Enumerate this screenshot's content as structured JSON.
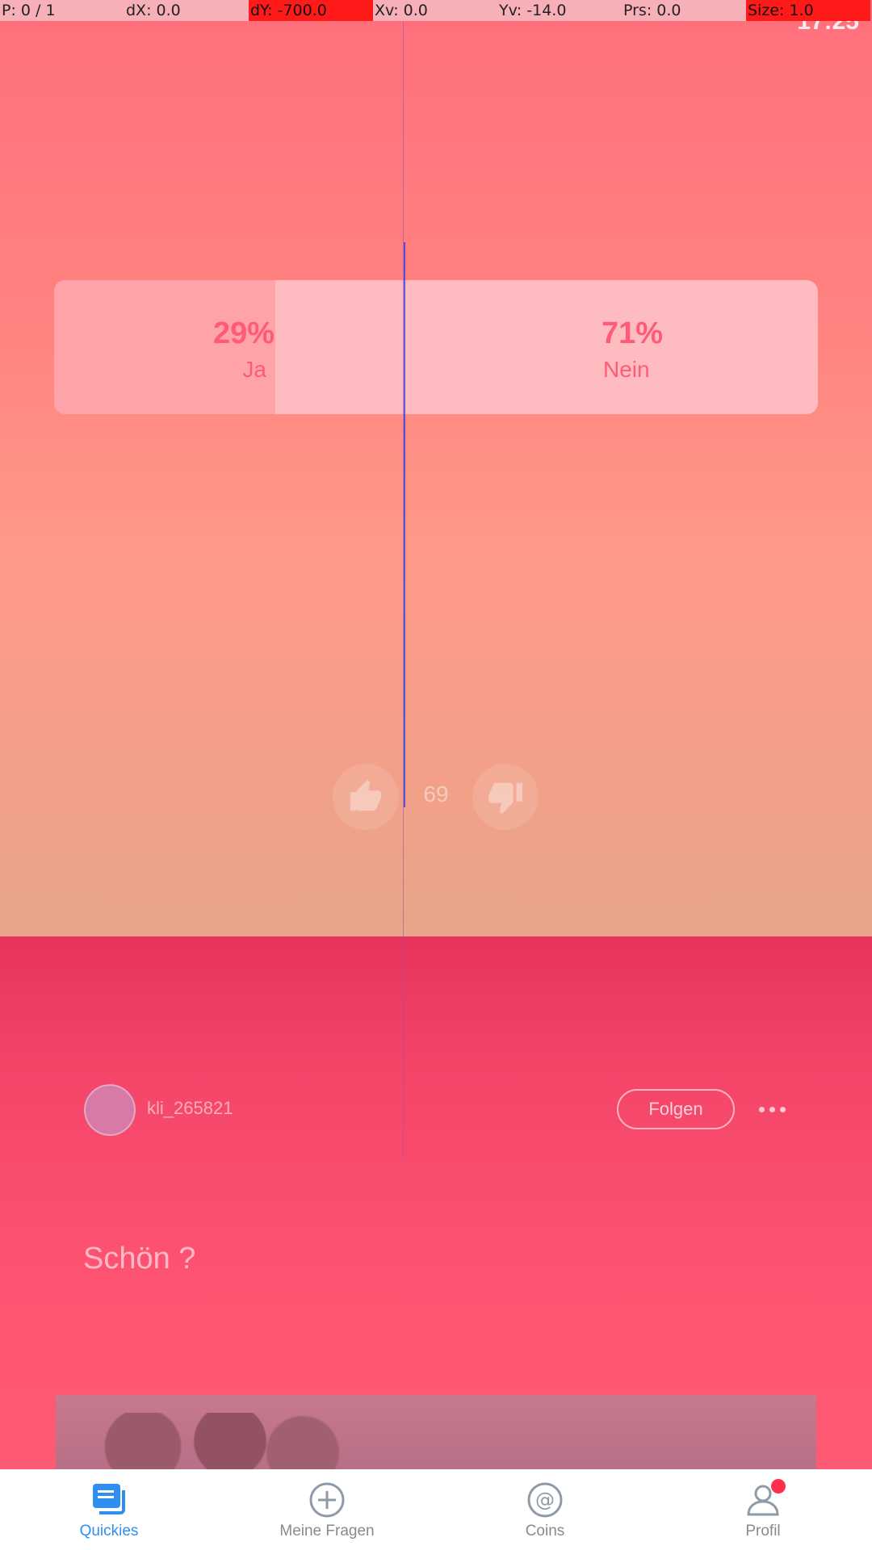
{
  "debug": {
    "pointer": "P: 0 / 1",
    "dx": "dX: 0.0",
    "dy": "dY: -700.0",
    "xv": "Xv: 0.0",
    "yv": "Yv: -14.0",
    "prs": "Prs: 0.0",
    "size": "Size: 1.0"
  },
  "status_bar": {
    "time": "17:25"
  },
  "poll_result": {
    "yes_percent": "29%",
    "yes_label": "Ja",
    "yes_fraction": 0.29,
    "no_percent": "71%",
    "no_label": "Nein"
  },
  "votes": {
    "count": "69"
  },
  "question": {
    "username": "kli_265821",
    "follow_label": "Folgen",
    "text": "Schön ?"
  },
  "nav": {
    "items": [
      {
        "label": "Quickies",
        "icon": "quickies-icon",
        "active": true
      },
      {
        "label": "Meine Fragen",
        "icon": "add-circle-icon",
        "active": false
      },
      {
        "label": "Coins",
        "icon": "at-coin-icon",
        "active": false
      },
      {
        "label": "Profil",
        "icon": "profile-icon",
        "active": false
      }
    ]
  },
  "colors": {
    "accent": "#2f8ff0",
    "brand": "#ff5a74",
    "notification": "#ff2f4f"
  }
}
